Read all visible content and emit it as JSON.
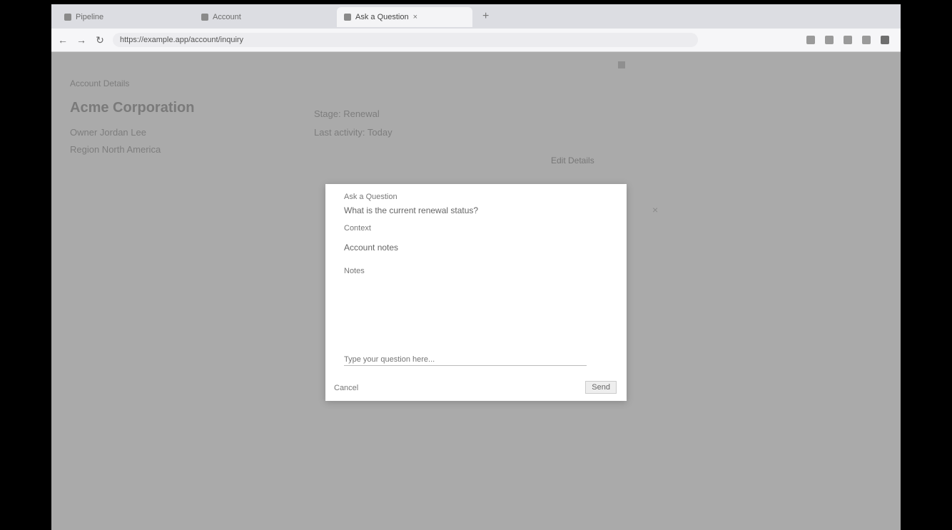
{
  "browser": {
    "tabs": [
      {
        "label": "Pipeline"
      },
      {
        "label": "Account"
      },
      {
        "label": "Ask a Question"
      }
    ],
    "address": "https://example.app/account/inquiry"
  },
  "page": {
    "header": "Account Details",
    "title": "Acme Corporation",
    "sub1": "Owner   Jordan Lee",
    "sub2": "Region  North America",
    "meta1": "Stage: Renewal",
    "meta2": "Last activity: Today",
    "link": "Edit Details"
  },
  "modal": {
    "label1": "Ask a Question",
    "value1": "What is the current renewal status?",
    "label2": "Context",
    "value2": "Account notes",
    "label3": "Notes",
    "input_placeholder": "Type your question here...",
    "footer_left": "Cancel",
    "footer_right": "Send"
  },
  "icons": {
    "back": "back-arrow-icon",
    "forward": "forward-arrow-icon",
    "reload": "reload-icon"
  }
}
